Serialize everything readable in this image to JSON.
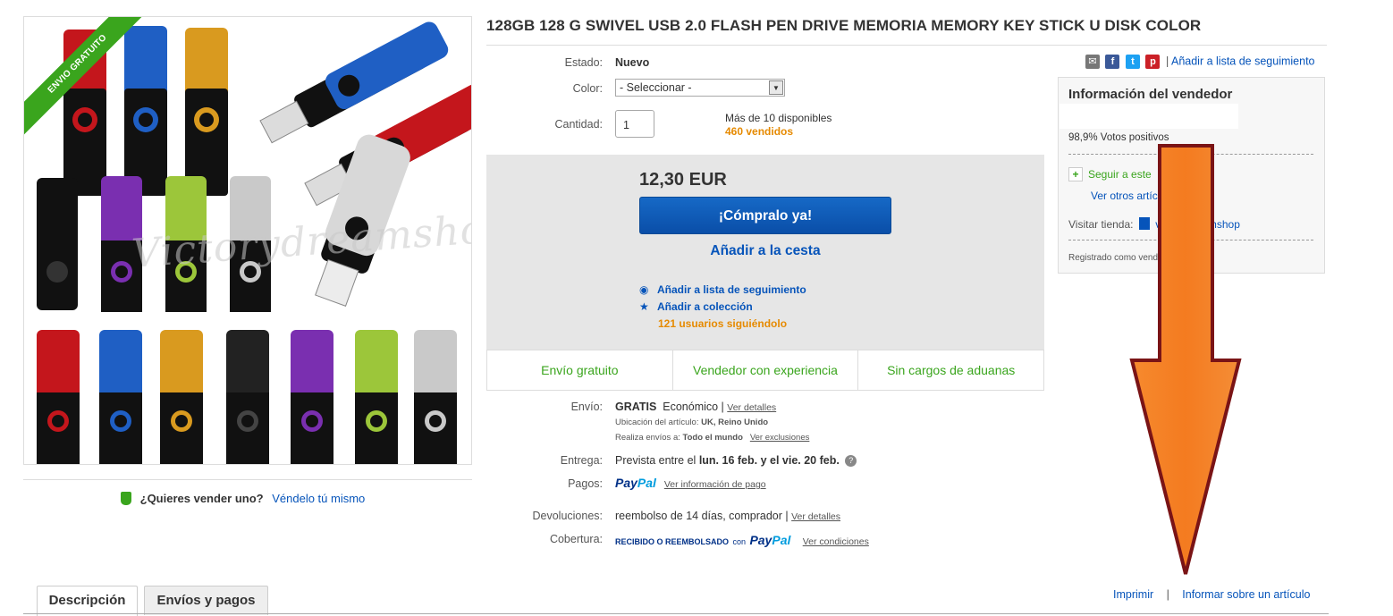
{
  "product": {
    "title": "128GB 128 G SWIVEL USB 2.0 FLASH PEN DRIVE MEMORIA MEMORY KEY STICK U DISK COLOR",
    "image_ribbon": "ENVIO GRATUITO",
    "image_watermark": "Victorydreamshop"
  },
  "sell": {
    "question": "¿Quieres vender uno?",
    "link": "Véndelo tú mismo"
  },
  "details": {
    "condition_label": "Estado:",
    "condition_value": "Nuevo",
    "color_label": "Color:",
    "color_value": "- Seleccionar -",
    "quantity_label": "Cantidad:",
    "quantity_value": "1",
    "available": "Más de 10 disponibles",
    "sold": "460 vendidos"
  },
  "buy": {
    "price": "12,30 EUR",
    "buy_now": "¡Cómpralo ya!",
    "add_to_cart": "Añadir a la cesta",
    "watch": "Añadir a lista de seguimiento",
    "collection": "Añadir a colección",
    "watchers": "121 usuarios siguiéndolo"
  },
  "badges": [
    "Envío gratuito",
    "Vendedor con experiencia",
    "Sin cargos de aduanas"
  ],
  "shipping": {
    "label": "Envío:",
    "free": "GRATIS",
    "method": "Económico |",
    "details_link": "Ver detalles",
    "location_label": "Ubicación del artículo:",
    "location": "UK, Reino Unido",
    "ships_to_label": "Realiza envíos a:",
    "ships_to": "Todo el mundo",
    "exclusions_link": "Ver exclusiones"
  },
  "delivery": {
    "label": "Entrega:",
    "prefix": "Prevista entre el",
    "dates": "lun. 16 feb. y el vie. 20 feb."
  },
  "payments": {
    "label": "Pagos:",
    "paypal_a": "Pay",
    "paypal_b": "Pal",
    "link": "Ver información de pago"
  },
  "returns": {
    "label": "Devoluciones:",
    "value": "reembolso de 14 días, comprador |",
    "link": "Ver detalles"
  },
  "coverage": {
    "label": "Cobertura:",
    "text": "RECIBIDO O REEMBOLSADO",
    "con": "con",
    "link": "Ver condiciones"
  },
  "share": {
    "watch_link": "Añadir a lista de seguimiento",
    "sep": "|"
  },
  "seller": {
    "heading": "Información del vendedor",
    "feedback": "98,9% Votos positivos",
    "follow": "Seguir a este",
    "other_items": "Ver otros artículos",
    "store_label": "Visitar tienda:",
    "store_name": "victorydreamshop",
    "registered": "Registrado como vendedor empresa"
  },
  "tabs": [
    "Descripción",
    "Envíos y pagos"
  ],
  "footer": {
    "print": "Imprimir",
    "sep": "|",
    "report": "Informar sobre un artículo"
  },
  "colors": {
    "link": "#0654ba",
    "green": "#3aa51d",
    "orange": "#e68a00",
    "arrow": "#f47b20"
  }
}
